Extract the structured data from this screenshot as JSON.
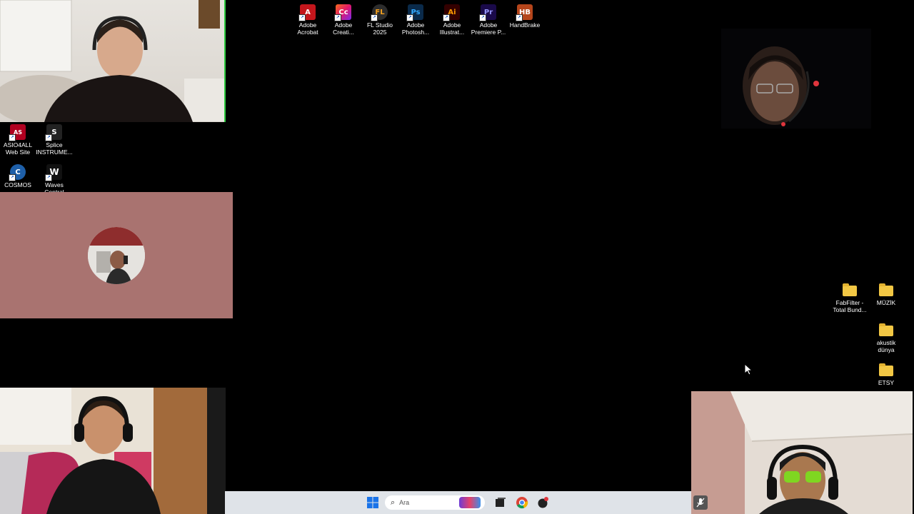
{
  "desktop_icons_top": [
    {
      "label": "Adobe\nAcrobat",
      "icon": "acrobat-icon",
      "color": "#c4161c",
      "glyph": "A"
    },
    {
      "label": "Adobe\nCreati...",
      "icon": "creative-cloud-icon",
      "color": "#e24a5a",
      "glyph": "Cc"
    },
    {
      "label": "FL Studio\n2025",
      "icon": "fl-studio-icon",
      "color": "#3a3a3a",
      "glyph": "FL"
    },
    {
      "label": "Adobe\nPhotosh...",
      "icon": "photoshop-icon",
      "color": "#0a2a4a",
      "glyph": "Ps"
    },
    {
      "label": "Adobe\nIllustrat...",
      "icon": "illustrator-icon",
      "color": "#330000",
      "glyph": "Ai"
    },
    {
      "label": "Adobe\nPremiere P...",
      "icon": "premiere-icon",
      "color": "#1a0a4a",
      "glyph": "Pr"
    },
    {
      "label": "HandBrake",
      "icon": "handbrake-icon",
      "color": "#b5451b",
      "glyph": "HB"
    }
  ],
  "desktop_icons_left": [
    {
      "label": "ASIO4ALL\nWeb Site",
      "icon": "asio4all-icon",
      "color": "#b00020",
      "glyph": "AS"
    },
    {
      "label": "Splice\nINSTRUME...",
      "icon": "splice-icon",
      "color": "#222222",
      "glyph": "S"
    },
    {
      "label": "COSMOS",
      "icon": "cosmos-icon",
      "color": "#1e5fa8",
      "glyph": "C"
    },
    {
      "label": "Waves\nCentral",
      "icon": "waves-icon",
      "color": "#111111",
      "glyph": "W"
    }
  ],
  "desktop_icons_right": [
    {
      "label": "FabFilter -\nTotal Bund...",
      "icon": "folder-icon"
    },
    {
      "label": "MÜZİK",
      "icon": "folder-icon"
    },
    {
      "label": "akustik\ndünya",
      "icon": "folder-icon"
    },
    {
      "label": "ETSY",
      "icon": "folder-icon"
    }
  ],
  "taskbar": {
    "search_placeholder": "Ara",
    "background": "#dfe3e8"
  },
  "colors": {
    "desktop": "#000000",
    "avatar_tile": "#a97370",
    "active_speaker_border": "#2ecc40"
  }
}
